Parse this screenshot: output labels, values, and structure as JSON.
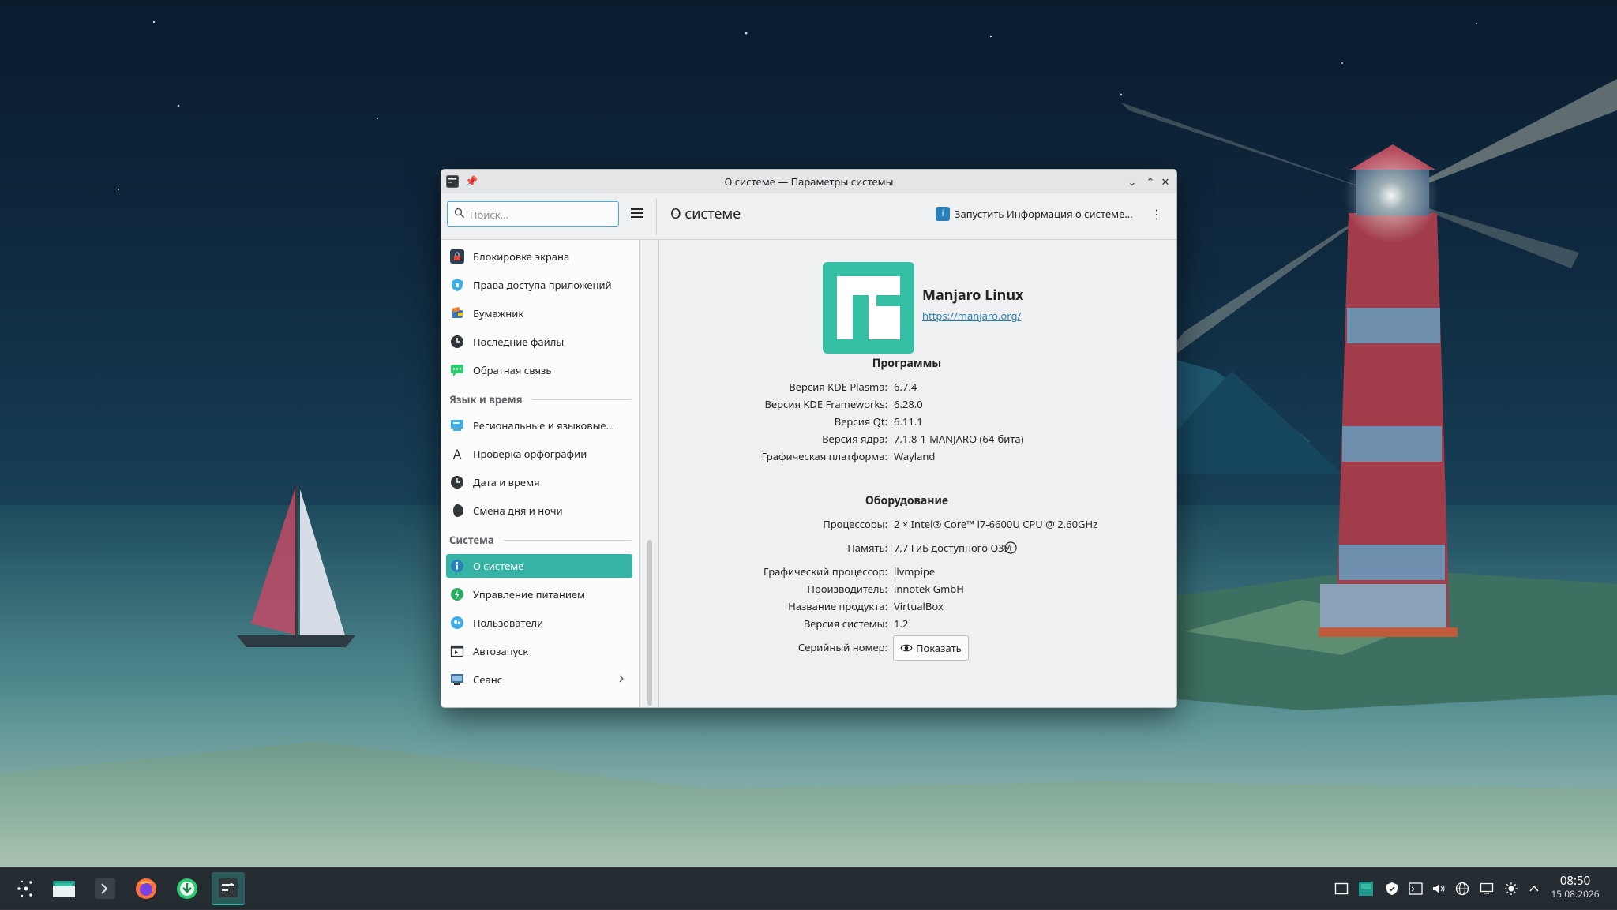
{
  "window": {
    "title": "О системе — Параметры системы",
    "page_title": "О системе",
    "search_placeholder": "Поиск...",
    "launch_label": "Запустить Информация о системе..."
  },
  "sidebar": {
    "items_top": [
      {
        "label": "Блокировка экрана",
        "icon": "lock-screen-icon"
      },
      {
        "label": "Права доступа приложений",
        "icon": "shield-icon"
      },
      {
        "label": "Бумажник",
        "icon": "wallet-icon"
      },
      {
        "label": "Последние файлы",
        "icon": "clock-icon"
      },
      {
        "label": "Обратная связь",
        "icon": "chat-icon"
      }
    ],
    "group_lang": "Язык и время",
    "items_lang": [
      {
        "label": "Региональные и языковые...",
        "icon": "region-icon"
      },
      {
        "label": "Проверка орфографии",
        "icon": "spellcheck-icon"
      },
      {
        "label": "Дата и время",
        "icon": "clock-icon"
      },
      {
        "label": "Смена дня и ночи",
        "icon": "day-night-icon"
      }
    ],
    "group_system": "Система",
    "items_system": [
      {
        "label": "О системе",
        "icon": "info-icon"
      },
      {
        "label": "Управление питанием",
        "icon": "power-icon"
      },
      {
        "label": "Пользователи",
        "icon": "users-icon"
      },
      {
        "label": "Автозапуск",
        "icon": "autostart-icon"
      },
      {
        "label": "Сеанс",
        "icon": "session-icon"
      }
    ]
  },
  "about": {
    "distro_name": "Manjaro Linux",
    "distro_url": "https://manjaro.org/",
    "software_title": "Программы",
    "software": [
      {
        "key": "Версия KDE Plasma:",
        "value": "6.7.4"
      },
      {
        "key": "Версия KDE Frameworks:",
        "value": "6.28.0"
      },
      {
        "key": "Версия Qt:",
        "value": "6.11.1"
      },
      {
        "key": "Версия ядра:",
        "value": "7.1.8-1-MANJARO (64-бита)"
      },
      {
        "key": "Графическая платформа:",
        "value": "Wayland"
      }
    ],
    "hardware_title": "Оборудование",
    "hardware": [
      {
        "key": "Процессоры:",
        "value": "2 × Intel® Core™ i7-6600U CPU @ 2.60GHz"
      },
      {
        "key": "Память:",
        "value": "7,7 ГиБ доступного ОЗУ"
      },
      {
        "key": "Графический процессор:",
        "value": "llvmpipe"
      },
      {
        "key": "Производитель:",
        "value": "innotek GmbH"
      },
      {
        "key": "Название продукта:",
        "value": "VirtualBox"
      },
      {
        "key": "Версия системы:",
        "value": "1.2"
      }
    ],
    "serial_key": "Серийный номер:",
    "show_button": "Показать"
  },
  "taskbar": {
    "time": "08:50",
    "date": "15.08.2026"
  },
  "colors": {
    "accent": "#37b3a5",
    "link": "#2980b9",
    "manjaro": "#35bf5c"
  }
}
